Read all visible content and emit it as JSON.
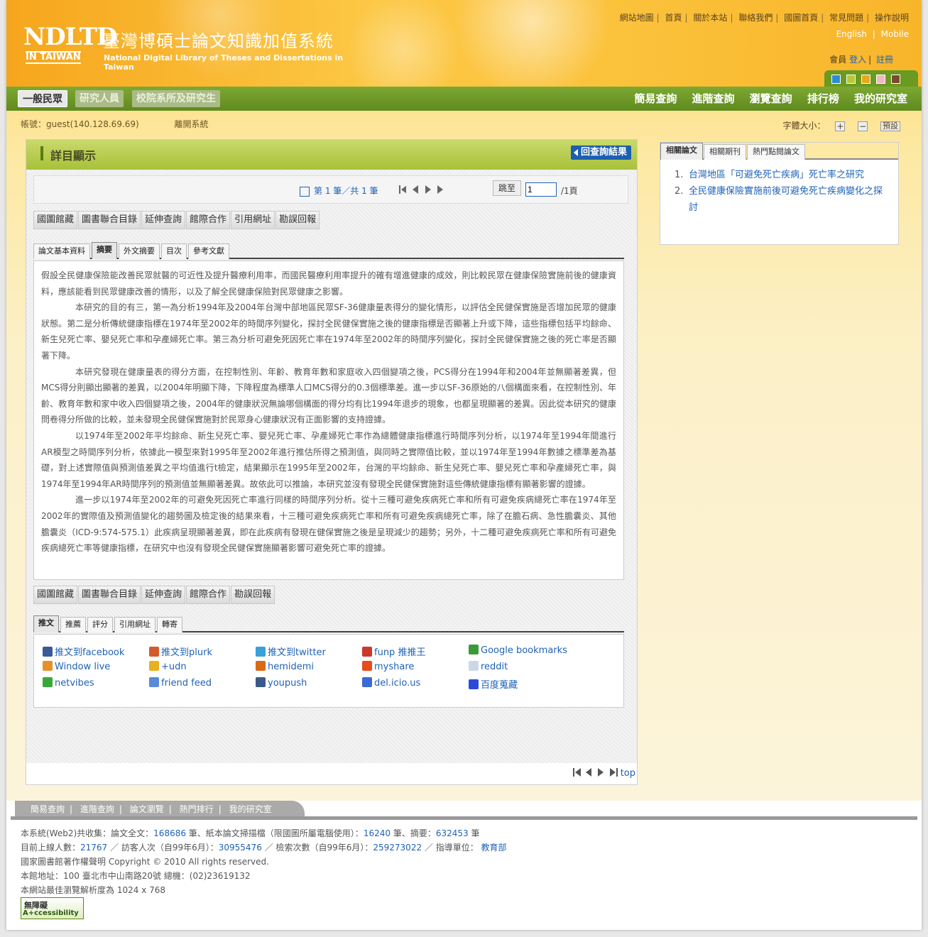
{
  "header": {
    "logo_ndltd": "NDLTD",
    "logo_intaiwan": "IN TAIWAN",
    "title_cn": "臺灣博碩士論文知識加值系統",
    "title_en": "National Digital Library of Theses and Dissertations in Taiwan",
    "top_links": [
      "網站地圖",
      "首頁",
      "關於本站",
      "聯絡我們",
      "國圖首頁",
      "常見問題",
      "操作說明"
    ],
    "lang_links": [
      "English",
      "Mobile"
    ],
    "member_label": "會員",
    "login": "登入",
    "register": "註冊",
    "theme_colors": [
      "#2f8bd0",
      "#b8c838",
      "#e8a818",
      "#f0b8c0",
      "#7a4a2a"
    ]
  },
  "nav": {
    "roles": [
      "一般民眾",
      "研究人員",
      "校院系所及研究生"
    ],
    "main": [
      "簡易查詢",
      "進階查詢",
      "瀏覽查詢",
      "排行榜",
      "我的研究室"
    ]
  },
  "account": {
    "label": "帳號：guest(140.128.69.69)",
    "logout": "離開系統",
    "fontsize_label": "字體大小：",
    "plus": "+",
    "minus": "−",
    "default": "預設"
  },
  "main": {
    "title": "詳目顯示",
    "back_button": "回查詢結果",
    "pager": {
      "text": "第 1 筆／共 1 筆",
      "jump_label": "跳至",
      "jump_value": "1",
      "total_pages": "/1頁"
    },
    "toolbar_top": [
      "國圖館藏",
      "圖書聯合目錄",
      "延伸查詢",
      "館際合作",
      "引用網址",
      "勘誤回報"
    ],
    "tabs": [
      "論文基本資料",
      "摘要",
      "外文摘要",
      "目次",
      "參考文獻"
    ],
    "abstract": [
      "假設全民健康保險能改善民眾就醫的可近性及提升醫療利用率，而國民醫療利用率提升的確有增進健康的成效，則比較民眾在健康保險實施前後的健康資料，應該能看到民眾健康改善的情形，以及了解全民健康保險對民眾健康之影響。",
      "本研究的目的有三，第一為分析1994年及2004年台灣中部地區民眾SF-36健康量表得分的變化情形，以評估全民健保實施是否增加民眾的健康狀態。第二是分析傳統健康指標在1974年至2002年的時間序列變化，探討全民健保實施之後的健康指標是否顯著上升或下降，這些指標包括平均餘命、新生兒死亡率、嬰兒死亡率和孕產婦死亡率。第三為分析可避免死因死亡率在1974年至2002年的時間序列變化，探討全民健保實施之後的死亡率是否顯著下降。",
      "本研究發現在健康量表的得分方面，在控制性別、年齡、教育年數和家庭收入四個變項之後，PCS得分在1994年和2004年並無顯著差異，但MCS得分則顯出顯著的差異，以2004年明顯下降，下降程度為標準人口MCS得分的0.3個標準差。進一步以SF-36原始的八個構面來看，在控制性別、年齡、教育年數和家中收入四個變項之後，2004年的健康狀況無論哪個構面的得分均有比1994年退步的現象，也都呈現顯著的差異。因此從本研究的健康問卷得分所做的比較，並未發現全民健保實施對於民眾身心健康狀況有正面影響的支持證據。",
      "以1974年至2002年平均餘命、新生兒死亡率、嬰兒死亡率、孕產婦死亡率作為總體健康指標進行時間序列分析，以1974年至1994年間進行AR模型之時間序列分析，依據此一模型來對1995年至2002年進行推估所得之預測值，與同時之實際值比較，並以1974年至1994年數據之標準差為基礎，對上述實際值與預測值差異之平均值進行t檢定，結果顯示在1995年至2002年，台灣的平均餘命、新生兒死亡率、嬰兒死亡率和孕產婦死亡率，與1974年至1994年AR時間序列的預測值並無顯著差異。故依此可以推論，本研究並沒有發現全民健保實施對這些傳統健康指標有顯著影響的證據。",
      "進一步以1974年至2002年的可避免死因死亡率進行同樣的時間序列分析。從十三種可避免疾病死亡率和所有可避免疾病總死亡率在1974年至2002年的實際值及預測值變化的趨勢圖及檢定後的結果來看，十三種可避免疾病死亡率和所有可避免疾病總死亡率，除了在膽石病、急性膽囊炎、其他膽囊炎（ICD-9:574-575.1）此疾病呈現顯著差異，即在此疾病有發現在健保實施之後是呈現減少的趨勢；另外，十二種可避免疾病死亡率和所有可避免疾病總死亡率等健康指標，在研究中也沒有發現全民健保實施顯著影響可避免死亡率的證據。"
    ],
    "toolbar_bottom": [
      "國圖館藏",
      "圖書聯合目錄",
      "延伸查詢",
      "館際合作",
      "勘誤回報"
    ],
    "share_tabs": [
      "推文",
      "推薦",
      "評分",
      "引用網址",
      "轉寄"
    ],
    "share_links": [
      {
        "label": "推文到facebook",
        "icon": "facebook-icon",
        "color": "#3b5998"
      },
      {
        "label": "推文到plurk",
        "icon": "plurk-icon",
        "color": "#d55a2a"
      },
      {
        "label": "推文到twitter",
        "icon": "twitter-icon",
        "color": "#3aa0d8"
      },
      {
        "label": "funp 推推王",
        "icon": "funp-icon",
        "color": "#c83a2a"
      },
      {
        "label": "Google bookmarks",
        "icon": "google-icon",
        "color": "#3a9a3a"
      },
      {
        "label": "Window live",
        "icon": "windows-live-icon",
        "color": "#e8902a"
      },
      {
        "label": "+udn",
        "icon": "udn-icon",
        "color": "#e8b020"
      },
      {
        "label": "hemidemi",
        "icon": "hemidemi-icon",
        "color": "#d86a1a"
      },
      {
        "label": "myshare",
        "icon": "myshare-icon",
        "color": "#e84a1a"
      },
      {
        "label": "reddit",
        "icon": "reddit-icon",
        "color": "#ccd8e8"
      },
      {
        "label": "netvibes",
        "icon": "netvibes-icon",
        "color": "#38a838"
      },
      {
        "label": "friend feed",
        "icon": "friendfeed-icon",
        "color": "#5a8ad8"
      },
      {
        "label": "youpush",
        "icon": "youpush-icon",
        "color": "#3a5a8a"
      },
      {
        "label": "del.icio.us",
        "icon": "delicious-icon",
        "color": "#3a6ad8"
      },
      {
        "label": "百度蒐藏",
        "icon": "baidu-icon",
        "color": "#2a4ad8"
      }
    ],
    "top_link": "top"
  },
  "side": {
    "tabs": [
      "相關論文",
      "相關期刊",
      "熱門點閱論文"
    ],
    "items": [
      {
        "num": "1.",
        "title": "台灣地區「可避免死亡疾病」死亡率之研究"
      },
      {
        "num": "2.",
        "title": "全民健康保險實施前後可避免死亡疾病變化之探討"
      }
    ]
  },
  "footer": {
    "nav": [
      "簡易查詢",
      "進階查詢",
      "論文瀏覽",
      "熱門排行",
      "我的研究室"
    ],
    "line1_a": "本系統(Web2)共收集：論文全文：",
    "fulltext": "168686",
    "line1_b": " 筆、紙本論文掃描檔（限國圖所屬電腦使用）：",
    "scans": "16240",
    "line1_c": " 筆、摘要：",
    "abstracts": "632453",
    "line1_d": " 筆",
    "line2_a": "目前上線人數：",
    "online": "21767",
    "line2_b": " ／ 訪客人次（自99年6月）：",
    "visitors": "30955476",
    "line2_c": " ／ 檢索次數（自99年6月）：",
    "searches": "259273022",
    "line2_d": " ／ 指導單位： ",
    "ministry": "教育部",
    "copyright": "國家圖書館著作權聲明 Copyright © 2010 All rights reserved.",
    "address": "本館地址：100 臺北市中山南路20號 總機：(02)23619132",
    "resolution": "本網站最佳瀏覽解析度為 1024 x 768",
    "a11y_1": "無障礙",
    "a11y_2": "A+ccessibility"
  }
}
